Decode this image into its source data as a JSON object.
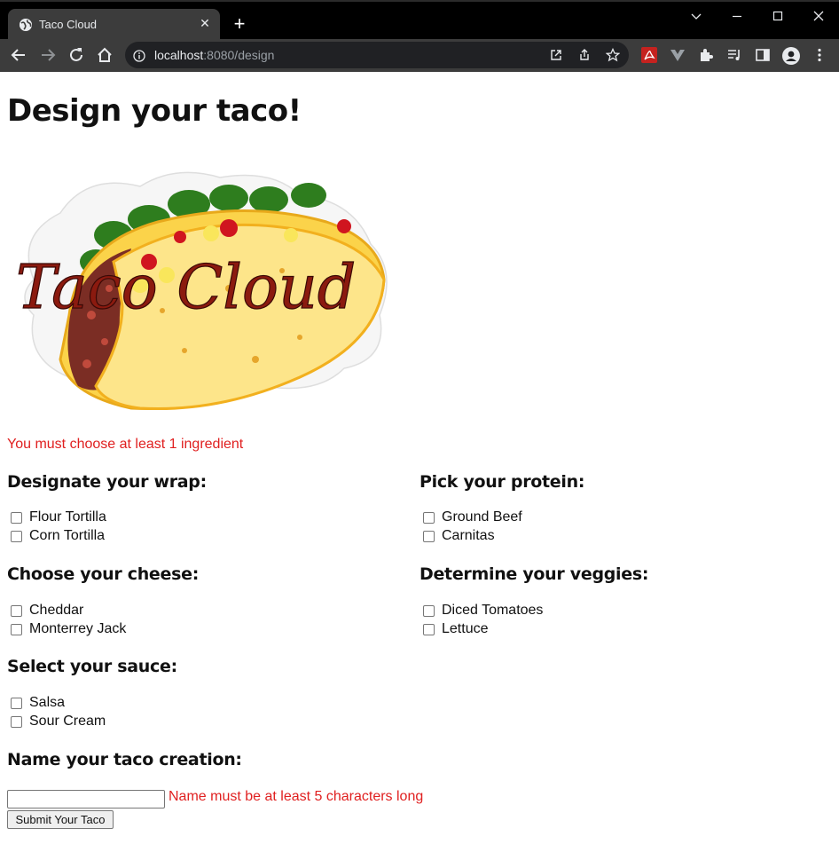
{
  "browser": {
    "tab_title": "Taco Cloud",
    "tab_close": "✕",
    "new_tab": "+",
    "url_host": "localhost",
    "url_rest": ":8080/design",
    "theme_colors": {
      "frame": "#000000",
      "toolbar": "#3c3c3c",
      "omnibox": "#202124",
      "text": "#e8eaed"
    }
  },
  "page": {
    "heading": "Design your taco!",
    "logo_text": "Taco Cloud",
    "ingredient_error": "You must choose at least 1 ingredient",
    "groups": {
      "wrap": {
        "title": "Designate your wrap:",
        "options": [
          "Flour Tortilla",
          "Corn Tortilla"
        ]
      },
      "protein": {
        "title": "Pick your protein:",
        "options": [
          "Ground Beef",
          "Carnitas"
        ]
      },
      "cheese": {
        "title": "Choose your cheese:",
        "options": [
          "Cheddar",
          "Monterrey Jack"
        ]
      },
      "veggies": {
        "title": "Determine your veggies:",
        "options": [
          "Diced Tomatoes",
          "Lettuce"
        ]
      },
      "sauce": {
        "title": "Select your sauce:",
        "options": [
          "Salsa",
          "Sour Cream"
        ]
      }
    },
    "name_title": "Name your taco creation:",
    "name_value": "",
    "name_error": "Name must be at least 5 characters long",
    "submit_label": "Submit Your Taco",
    "error_color": "#e02020"
  }
}
